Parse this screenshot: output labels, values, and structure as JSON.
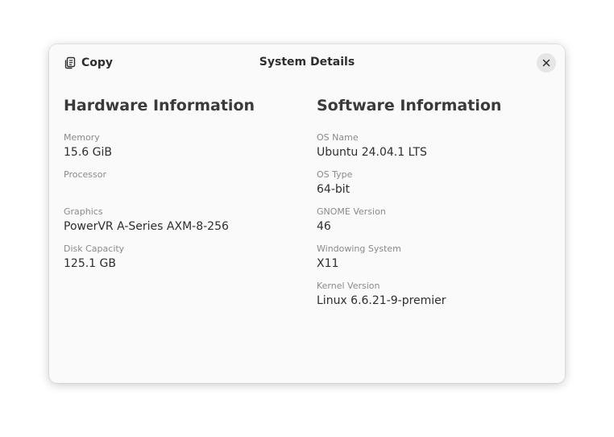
{
  "window": {
    "title": "System Details",
    "copy_label": "Copy",
    "copy_icon": "copy-icon",
    "close_icon": "close-icon"
  },
  "hardware": {
    "title": "Hardware Information",
    "fields": [
      {
        "label": "Memory",
        "value": "15.6 GiB"
      },
      {
        "label": "Processor",
        "value": ""
      },
      {
        "label": "Graphics",
        "value": "PowerVR A-Series AXM-8-256"
      },
      {
        "label": "Disk Capacity",
        "value": "125.1 GB"
      }
    ]
  },
  "software": {
    "title": "Software Information",
    "fields": [
      {
        "label": "OS Name",
        "value": "Ubuntu 24.04.1 LTS"
      },
      {
        "label": "OS Type",
        "value": "64-bit"
      },
      {
        "label": "GNOME Version",
        "value": "46"
      },
      {
        "label": "Windowing System",
        "value": "X11"
      },
      {
        "label": "Kernel Version",
        "value": "Linux 6.6.21-9-premier"
      }
    ]
  }
}
